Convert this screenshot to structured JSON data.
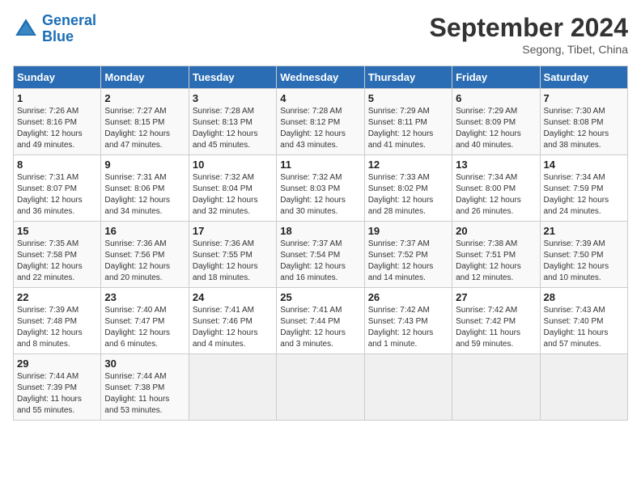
{
  "header": {
    "logo_line1": "General",
    "logo_line2": "Blue",
    "month": "September 2024",
    "location": "Segong, Tibet, China"
  },
  "weekdays": [
    "Sunday",
    "Monday",
    "Tuesday",
    "Wednesday",
    "Thursday",
    "Friday",
    "Saturday"
  ],
  "weeks": [
    [
      {
        "day": "1",
        "info": "Sunrise: 7:26 AM\nSunset: 8:16 PM\nDaylight: 12 hours\nand 49 minutes."
      },
      {
        "day": "2",
        "info": "Sunrise: 7:27 AM\nSunset: 8:15 PM\nDaylight: 12 hours\nand 47 minutes."
      },
      {
        "day": "3",
        "info": "Sunrise: 7:28 AM\nSunset: 8:13 PM\nDaylight: 12 hours\nand 45 minutes."
      },
      {
        "day": "4",
        "info": "Sunrise: 7:28 AM\nSunset: 8:12 PM\nDaylight: 12 hours\nand 43 minutes."
      },
      {
        "day": "5",
        "info": "Sunrise: 7:29 AM\nSunset: 8:11 PM\nDaylight: 12 hours\nand 41 minutes."
      },
      {
        "day": "6",
        "info": "Sunrise: 7:29 AM\nSunset: 8:09 PM\nDaylight: 12 hours\nand 40 minutes."
      },
      {
        "day": "7",
        "info": "Sunrise: 7:30 AM\nSunset: 8:08 PM\nDaylight: 12 hours\nand 38 minutes."
      }
    ],
    [
      {
        "day": "8",
        "info": "Sunrise: 7:31 AM\nSunset: 8:07 PM\nDaylight: 12 hours\nand 36 minutes."
      },
      {
        "day": "9",
        "info": "Sunrise: 7:31 AM\nSunset: 8:06 PM\nDaylight: 12 hours\nand 34 minutes."
      },
      {
        "day": "10",
        "info": "Sunrise: 7:32 AM\nSunset: 8:04 PM\nDaylight: 12 hours\nand 32 minutes."
      },
      {
        "day": "11",
        "info": "Sunrise: 7:32 AM\nSunset: 8:03 PM\nDaylight: 12 hours\nand 30 minutes."
      },
      {
        "day": "12",
        "info": "Sunrise: 7:33 AM\nSunset: 8:02 PM\nDaylight: 12 hours\nand 28 minutes."
      },
      {
        "day": "13",
        "info": "Sunrise: 7:34 AM\nSunset: 8:00 PM\nDaylight: 12 hours\nand 26 minutes."
      },
      {
        "day": "14",
        "info": "Sunrise: 7:34 AM\nSunset: 7:59 PM\nDaylight: 12 hours\nand 24 minutes."
      }
    ],
    [
      {
        "day": "15",
        "info": "Sunrise: 7:35 AM\nSunset: 7:58 PM\nDaylight: 12 hours\nand 22 minutes."
      },
      {
        "day": "16",
        "info": "Sunrise: 7:36 AM\nSunset: 7:56 PM\nDaylight: 12 hours\nand 20 minutes."
      },
      {
        "day": "17",
        "info": "Sunrise: 7:36 AM\nSunset: 7:55 PM\nDaylight: 12 hours\nand 18 minutes."
      },
      {
        "day": "18",
        "info": "Sunrise: 7:37 AM\nSunset: 7:54 PM\nDaylight: 12 hours\nand 16 minutes."
      },
      {
        "day": "19",
        "info": "Sunrise: 7:37 AM\nSunset: 7:52 PM\nDaylight: 12 hours\nand 14 minutes."
      },
      {
        "day": "20",
        "info": "Sunrise: 7:38 AM\nSunset: 7:51 PM\nDaylight: 12 hours\nand 12 minutes."
      },
      {
        "day": "21",
        "info": "Sunrise: 7:39 AM\nSunset: 7:50 PM\nDaylight: 12 hours\nand 10 minutes."
      }
    ],
    [
      {
        "day": "22",
        "info": "Sunrise: 7:39 AM\nSunset: 7:48 PM\nDaylight: 12 hours\nand 8 minutes."
      },
      {
        "day": "23",
        "info": "Sunrise: 7:40 AM\nSunset: 7:47 PM\nDaylight: 12 hours\nand 6 minutes."
      },
      {
        "day": "24",
        "info": "Sunrise: 7:41 AM\nSunset: 7:46 PM\nDaylight: 12 hours\nand 4 minutes."
      },
      {
        "day": "25",
        "info": "Sunrise: 7:41 AM\nSunset: 7:44 PM\nDaylight: 12 hours\nand 3 minutes."
      },
      {
        "day": "26",
        "info": "Sunrise: 7:42 AM\nSunset: 7:43 PM\nDaylight: 12 hours\nand 1 minute."
      },
      {
        "day": "27",
        "info": "Sunrise: 7:42 AM\nSunset: 7:42 PM\nDaylight: 11 hours\nand 59 minutes."
      },
      {
        "day": "28",
        "info": "Sunrise: 7:43 AM\nSunset: 7:40 PM\nDaylight: 11 hours\nand 57 minutes."
      }
    ],
    [
      {
        "day": "29",
        "info": "Sunrise: 7:44 AM\nSunset: 7:39 PM\nDaylight: 11 hours\nand 55 minutes."
      },
      {
        "day": "30",
        "info": "Sunrise: 7:44 AM\nSunset: 7:38 PM\nDaylight: 11 hours\nand 53 minutes."
      },
      {
        "day": "",
        "info": ""
      },
      {
        "day": "",
        "info": ""
      },
      {
        "day": "",
        "info": ""
      },
      {
        "day": "",
        "info": ""
      },
      {
        "day": "",
        "info": ""
      }
    ]
  ]
}
